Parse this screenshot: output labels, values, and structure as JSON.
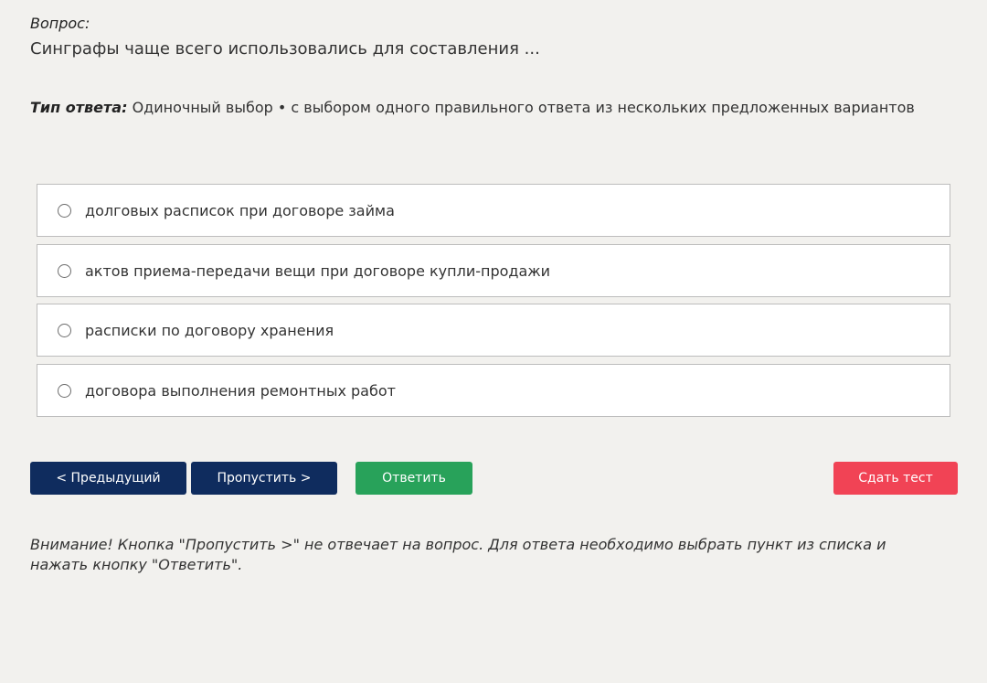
{
  "question": {
    "label": "Вопрос:",
    "text": "Синграфы чаще всего использовались для составления ..."
  },
  "answer_type": {
    "label": "Тип ответа:",
    "value": "Одиночный выбор • с выбором одного правильного ответа из нескольких предложенных вариантов"
  },
  "options": [
    {
      "label": "долговых расписок при договоре займа",
      "selected": false
    },
    {
      "label": "актов приема-передачи вещи при договоре купли-продажи",
      "selected": false
    },
    {
      "label": "расписки по договору хранения",
      "selected": false
    },
    {
      "label": "договора выполнения ремонтных работ",
      "selected": false
    }
  ],
  "buttons": {
    "prev": "< Предыдущий",
    "skip": "Пропустить >",
    "answer": "Ответить",
    "submit": "Сдать тест"
  },
  "notice": "Внимание! Кнопка \"Пропустить >\" не отвечает на вопрос. Для ответа необходимо выбрать пункт из списка и нажать кнопку \"Ответить\".",
  "colors": {
    "background": "#f2f1ee",
    "navy_button": "#0f2c5e",
    "green_button": "#28a25a",
    "red_button": "#f14355"
  }
}
